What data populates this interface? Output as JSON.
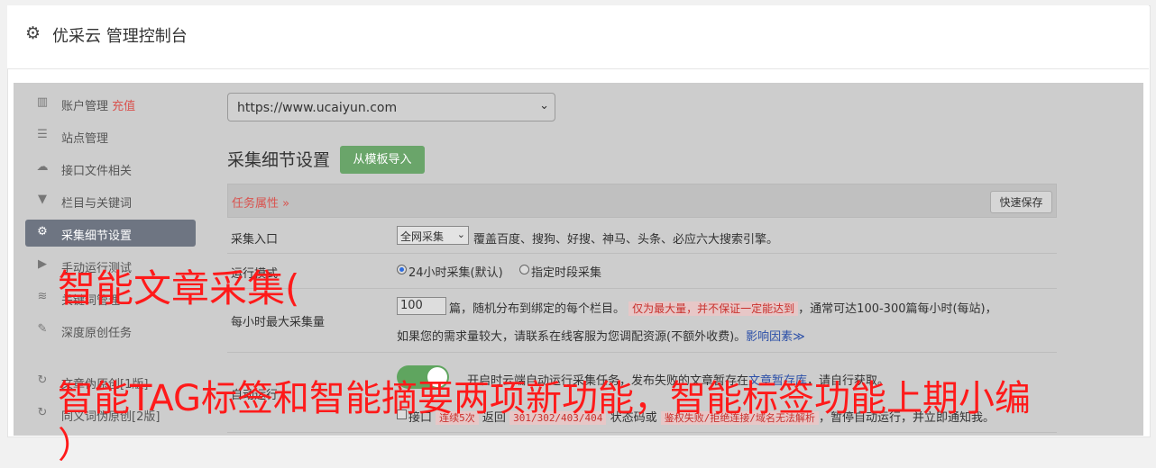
{
  "header": {
    "title": "优采云 管理控制台"
  },
  "sidebar": {
    "items": [
      {
        "label": "账户管理",
        "extra": "充值"
      },
      {
        "label": "站点管理"
      },
      {
        "label": "接口文件相关"
      },
      {
        "label": "栏目与关键词"
      },
      {
        "label": "采集细节设置"
      },
      {
        "label": "手动运行测试"
      },
      {
        "label": "关键词管理"
      },
      {
        "label": "深度原创任务"
      },
      {
        "label": "文章伪原创[1版]"
      },
      {
        "label": "同义词伪原创[2版]"
      }
    ]
  },
  "main": {
    "site_select": {
      "value": "https://www.ucaiyun.com"
    },
    "section_title": "采集细节设置",
    "import_button": "从模板导入",
    "panel": {
      "title": "任务属性",
      "save_button": "快速保存"
    },
    "rows": {
      "entry": {
        "label": "采集入口",
        "select_value": "全网采集",
        "description": "覆盖百度、搜狗、好搜、神马、头条、必应六大搜索引擎。"
      },
      "mode": {
        "label": "运行模式",
        "option1": "24小时采集(默认)",
        "option2": "指定时段采集"
      },
      "max": {
        "label": "每小时最大采集量",
        "value": "100",
        "text1": "篇，随机分布到绑定的每个栏目。",
        "badge": "仅为最大量，并不保证一定能达到",
        "text2": "，通常可达100-300篇每小时(每站)，",
        "text3": "如果您的需求量较大，请联系在线客服为您调配资源(不额外收费)。",
        "link": "影响因素"
      },
      "auto": {
        "label": "自动运行",
        "text": "开启时云端自动运行采集任务，发布失败的文章暂存在",
        "link": "文章暂存库",
        "text_end": "，请自行获取。"
      },
      "fail": {
        "checkbox_label": "接口",
        "t1": "连续5次",
        "t2": "返回",
        "codes": "301/302/403/404",
        "t3": "状态码或",
        "t4": "鉴权失败/拒绝连接/域名无法解析",
        "t5": "，暂停自动运行，并立即通知我。"
      }
    }
  },
  "overlay": {
    "line1": "智能文章采集(",
    "line2": "智能TAG标签和智能摘要两项新功能，智能标签功能上期小编",
    "line3": "）"
  },
  "colors": {
    "accent_green": "#6aa56a",
    "active_nav": "#6e7582",
    "overlay_red": "#ff1a1a"
  }
}
